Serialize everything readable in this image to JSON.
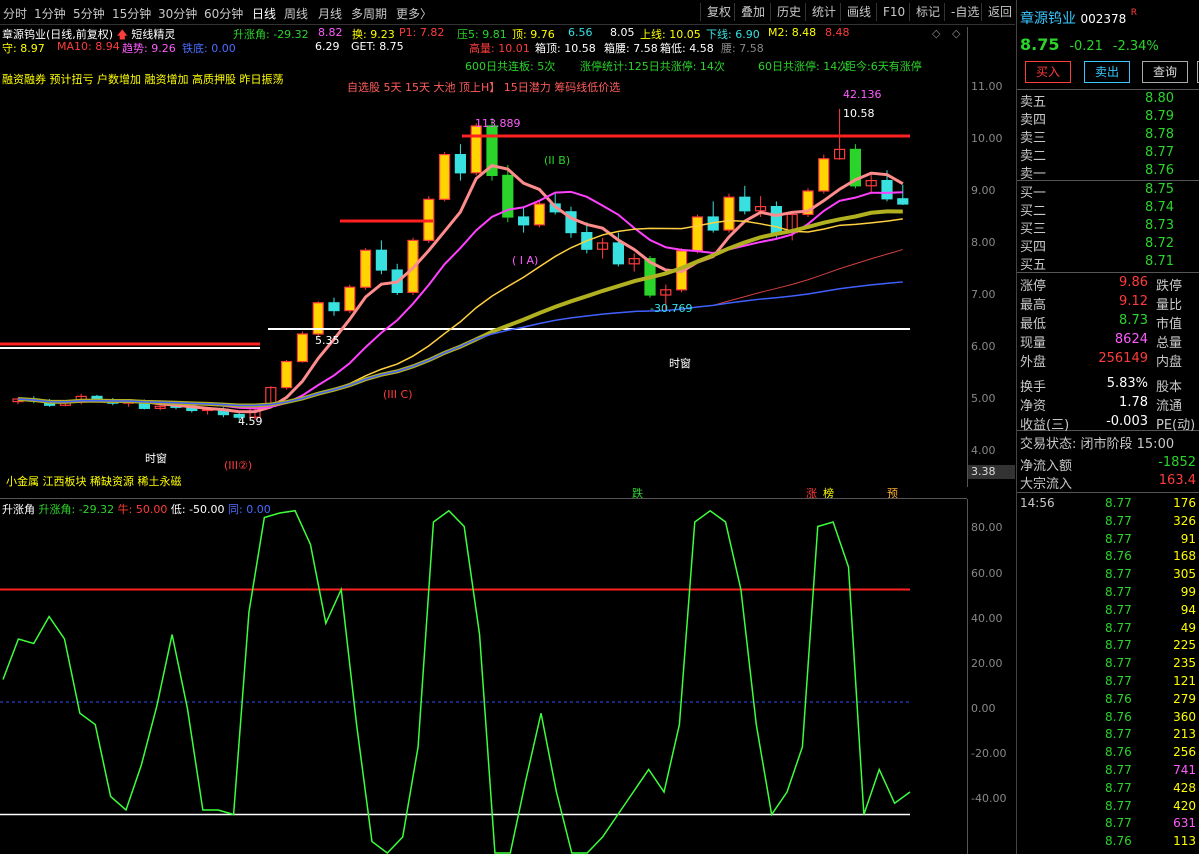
{
  "toolbar": {
    "periods": [
      "分时",
      "1分钟",
      "5分钟",
      "15分钟",
      "30分钟",
      "60分钟",
      "日线",
      "周线",
      "月线",
      "多周期",
      "更多〉"
    ],
    "selected": "日线",
    "right_buttons": [
      "复权",
      "叠加",
      "历史",
      "统计",
      "画线",
      "F10",
      "标记",
      "-自选",
      "返回"
    ]
  },
  "indicators_line1": {
    "stock": "章源钨业(日线,前复权)",
    "tool": "短线精灵",
    "rise_angle": "升涨角: -29.32",
    "v1": "8.82",
    "huan": "换: 9.23",
    "p1": "P1: 7.82",
    "ya5": "压5: 9.81",
    "ding": "顶: 9.76",
    "v2": "6.56",
    "v3": "8.05",
    "shangxian": "上线: 10.05",
    "xiaxian": "下线: 6.90",
    "m2": "M2: 8.48",
    "m2v": "8.48"
  },
  "indicators_line2": {
    "shou": "守: 8.97",
    "ma10": "MA10: 8.94",
    "qushi": "趋势: 9.26",
    "tiedi": "铁底: 0.00",
    "v1": "6.29",
    "get": "GET: 8.75",
    "gaoliang": "高量: 10.01",
    "xiangding": "箱顶: 10.58",
    "xiangyao": "箱腰: 7.58",
    "xiangdi": "箱低: 4.58",
    "yao": "腰: 7.58"
  },
  "indicators_line3": {
    "tags": "融资融券 预计扭亏 户数增加 融资增加 高质押股 昨日振荡",
    "lianban": "600日共连板: 5次",
    "zhangting": "涨停统计:125日共涨停: 14次",
    "gongzhang": "60日共涨停: 14次",
    "juli": "距今:6天有涨停"
  },
  "indicators_line4": "自选股 5天 15天 大池 顶上H】 15日潜力 筹码线低价选",
  "chart_labels": {
    "high_mark": "42.136",
    "peak_price": "10.58",
    "mark_113": "113.889",
    "low_mark": "4.59",
    "low_ann": "-30.769",
    "left_ann": "5.35",
    "shizhang": "时窗",
    "price_badge": "3.38",
    "ia": "( I A)",
    "iib": "(II B)",
    "iic": "(III C)",
    "iii2": "(III②)",
    "sector_tags": "小金属 江西板块 稀缺资源 稀土永磁",
    "bottom_tags": [
      "跌",
      "涨",
      "榜",
      "预"
    ]
  },
  "price_axis": [
    "11.00",
    "10.00",
    "9.00",
    "8.00",
    "7.00",
    "6.00",
    "5.00",
    "4.00"
  ],
  "osc": {
    "title": "升涨角",
    "value": "升涨角: -29.32",
    "niu": "牛: 50.00",
    "di": "低: -50.00",
    "tong": "同: 0.00",
    "axis": [
      "80.00",
      "60.00",
      "40.00",
      "20.00",
      "0.00",
      "-20.00",
      "-40.00"
    ]
  },
  "quote": {
    "name": "章源钨业",
    "code": "002378",
    "flag": "R",
    "price": "8.75",
    "change": "-0.21",
    "pct": "-2.34%",
    "buy_btn": "买入",
    "sell_btn": "卖出",
    "query_btn": "查询",
    "asks": [
      {
        "label": "卖五",
        "price": "8.80"
      },
      {
        "label": "卖四",
        "price": "8.79"
      },
      {
        "label": "卖三",
        "price": "8.78"
      },
      {
        "label": "卖二",
        "price": "8.77"
      },
      {
        "label": "卖一",
        "price": "8.76"
      }
    ],
    "bids": [
      {
        "label": "买一",
        "price": "8.75"
      },
      {
        "label": "买二",
        "price": "8.74"
      },
      {
        "label": "买三",
        "price": "8.73"
      },
      {
        "label": "买四",
        "price": "8.72"
      },
      {
        "label": "买五",
        "price": "8.71"
      }
    ],
    "stats": [
      {
        "k": "涨停",
        "v": "9.86",
        "k2": "跌停"
      },
      {
        "k": "最高",
        "v": "9.12",
        "k2": "量比"
      },
      {
        "k": "最低",
        "v": "8.73",
        "k2": "市值"
      },
      {
        "k": "现量",
        "v": "8624",
        "k2": "总量"
      },
      {
        "k": "外盘",
        "v": "256149",
        "k2": "内盘"
      },
      {
        "k": "换手",
        "v": "5.83%",
        "k2": "股本"
      },
      {
        "k": "净资",
        "v": "1.78",
        "k2": "流通"
      },
      {
        "k": "收益(三)",
        "v": "-0.003",
        "k2": "PE(动)"
      }
    ],
    "trade_state": "交易状态: 闭市阶段 15:00",
    "net_inflow_label": "净流入额",
    "net_inflow": "-1852",
    "block_label": "大宗流入",
    "block_inflow": "163.4",
    "ticks": [
      {
        "t": "14:56",
        "p": "8.77",
        "n": "176"
      },
      {
        "t": "",
        "p": "8.77",
        "n": "326"
      },
      {
        "t": "",
        "p": "8.77",
        "n": "91"
      },
      {
        "t": "",
        "p": "8.76",
        "n": "168"
      },
      {
        "t": "",
        "p": "8.77",
        "n": "305"
      },
      {
        "t": "",
        "p": "8.77",
        "n": "99"
      },
      {
        "t": "",
        "p": "8.77",
        "n": "94"
      },
      {
        "t": "",
        "p": "8.77",
        "n": "49"
      },
      {
        "t": "",
        "p": "8.77",
        "n": "225"
      },
      {
        "t": "",
        "p": "8.77",
        "n": "235"
      },
      {
        "t": "",
        "p": "8.77",
        "n": "121"
      },
      {
        "t": "",
        "p": "8.76",
        "n": "279"
      },
      {
        "t": "",
        "p": "8.76",
        "n": "360"
      },
      {
        "t": "",
        "p": "8.77",
        "n": "213"
      },
      {
        "t": "",
        "p": "8.76",
        "n": "256"
      },
      {
        "t": "",
        "p": "8.77",
        "n": "741"
      },
      {
        "t": "",
        "p": "8.77",
        "n": "428"
      },
      {
        "t": "",
        "p": "8.77",
        "n": "420"
      },
      {
        "t": "",
        "p": "8.77",
        "n": "631"
      },
      {
        "t": "",
        "p": "8.76",
        "n": "113"
      }
    ]
  },
  "colors": {
    "up": "#ff3c3c",
    "down": "#2bd42b",
    "accent_yellow": "#ffff00",
    "osc_line": "#3cff3c",
    "limit_red": "#ff2020"
  },
  "candles": [
    [
      4.95,
      5.02,
      4.9,
      5.0
    ],
    [
      5.0,
      5.05,
      4.92,
      4.96
    ],
    [
      4.96,
      5.0,
      4.85,
      4.88
    ],
    [
      4.88,
      4.98,
      4.86,
      4.94
    ],
    [
      4.94,
      5.1,
      4.9,
      5.05
    ],
    [
      5.05,
      5.08,
      4.95,
      4.98
    ],
    [
      4.98,
      5.02,
      4.88,
      4.92
    ],
    [
      4.92,
      5.0,
      4.85,
      4.96
    ],
    [
      4.96,
      4.99,
      4.8,
      4.82
    ],
    [
      4.82,
      4.9,
      4.78,
      4.86
    ],
    [
      4.86,
      4.92,
      4.8,
      4.84
    ],
    [
      4.84,
      4.88,
      4.74,
      4.78
    ],
    [
      4.78,
      4.85,
      4.7,
      4.8
    ],
    [
      4.8,
      4.84,
      4.65,
      4.7
    ],
    [
      4.7,
      4.76,
      4.59,
      4.65
    ],
    [
      4.65,
      4.88,
      4.6,
      4.86
    ],
    [
      4.86,
      5.25,
      4.84,
      5.22
    ],
    [
      5.22,
      5.75,
      5.18,
      5.72
    ],
    [
      5.72,
      6.3,
      5.7,
      6.25
    ],
    [
      6.25,
      6.88,
      6.2,
      6.85
    ],
    [
      6.85,
      6.95,
      6.6,
      6.7
    ],
    [
      6.7,
      7.2,
      6.65,
      7.15
    ],
    [
      7.15,
      7.9,
      7.1,
      7.86
    ],
    [
      7.86,
      8.05,
      7.4,
      7.48
    ],
    [
      7.48,
      7.6,
      7.0,
      7.05
    ],
    [
      7.05,
      8.1,
      7.0,
      8.05
    ],
    [
      8.05,
      8.9,
      8.0,
      8.84
    ],
    [
      8.84,
      9.75,
      8.8,
      9.7
    ],
    [
      9.7,
      9.9,
      9.2,
      9.35
    ],
    [
      9.35,
      10.3,
      9.3,
      10.25
    ],
    [
      10.25,
      10.4,
      9.2,
      9.3
    ],
    [
      9.3,
      9.5,
      8.4,
      8.5
    ],
    [
      8.5,
      8.7,
      8.2,
      8.35
    ],
    [
      8.35,
      8.8,
      8.3,
      8.75
    ],
    [
      8.75,
      8.95,
      8.55,
      8.6
    ],
    [
      8.6,
      8.7,
      8.1,
      8.2
    ],
    [
      8.2,
      8.4,
      7.8,
      7.88
    ],
    [
      7.88,
      8.1,
      7.7,
      8.0
    ],
    [
      8.0,
      8.2,
      7.55,
      7.6
    ],
    [
      7.6,
      7.8,
      7.45,
      7.7
    ],
    [
      7.7,
      7.75,
      6.95,
      7.0
    ],
    [
      7.0,
      7.2,
      6.7,
      7.1
    ],
    [
      7.1,
      7.9,
      7.05,
      7.85
    ],
    [
      7.85,
      8.55,
      7.8,
      8.5
    ],
    [
      8.5,
      8.8,
      8.2,
      8.25
    ],
    [
      8.25,
      8.95,
      8.2,
      8.88
    ],
    [
      8.88,
      9.1,
      8.55,
      8.62
    ],
    [
      8.62,
      8.9,
      8.5,
      8.7
    ],
    [
      8.7,
      8.8,
      8.1,
      8.2
    ],
    [
      8.2,
      8.6,
      8.05,
      8.55
    ],
    [
      8.55,
      9.05,
      8.5,
      9.0
    ],
    [
      9.0,
      9.7,
      8.95,
      9.62
    ],
    [
      9.62,
      10.58,
      9.6,
      9.8
    ],
    [
      9.8,
      9.9,
      9.05,
      9.1
    ],
    [
      9.1,
      9.35,
      8.95,
      9.2
    ],
    [
      9.2,
      9.4,
      8.8,
      8.85
    ],
    [
      8.85,
      9.12,
      8.73,
      8.75
    ]
  ],
  "osc_series": [
    10,
    28,
    26,
    38,
    28,
    -5,
    -10,
    -42,
    -48,
    -28,
    -2,
    30,
    -3,
    -48,
    -48,
    -50,
    40,
    82,
    84,
    85,
    70,
    35,
    50,
    -10,
    -62,
    -75,
    -60,
    -20,
    80,
    85,
    78,
    30,
    -70,
    -80,
    -35,
    -5,
    -40,
    -90,
    -85,
    -60,
    -50,
    -40,
    -30,
    -40,
    -10,
    80,
    85,
    80,
    50,
    -10,
    -50,
    -40,
    -20,
    78,
    80,
    60,
    -50,
    -30,
    -45,
    -40
  ]
}
